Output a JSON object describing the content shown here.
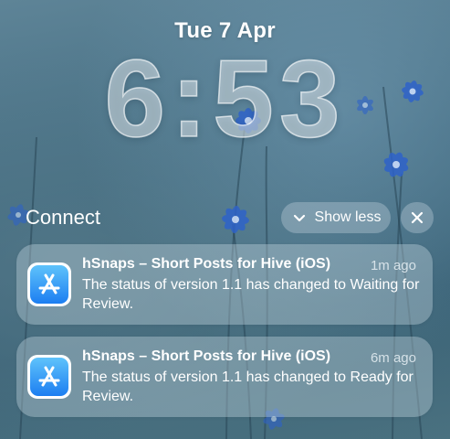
{
  "lockscreen": {
    "date": "Tue 7 Apr",
    "time": "6:53"
  },
  "group": {
    "title": "Connect",
    "show_less_label": "Show less",
    "chevron_icon": "chevron-down-icon",
    "close_icon": "close-icon"
  },
  "notifications": [
    {
      "app_icon": "app-store-connect-icon",
      "title": "hSnaps – Short Posts for Hive (iOS)",
      "time": "1m ago",
      "body": "The status of version 1.1 has changed to Waiting for Review."
    },
    {
      "app_icon": "app-store-connect-icon",
      "title": "hSnaps – Short Posts for Hive (iOS)",
      "time": "6m ago",
      "body": "The status of version 1.1 has changed to Ready for Review."
    }
  ],
  "colors": {
    "wallpaper_base": "#436c81",
    "flower": "#2f63c9",
    "app_icon_top": "#5fc3fb",
    "app_icon_bottom": "#1c7ef1"
  }
}
